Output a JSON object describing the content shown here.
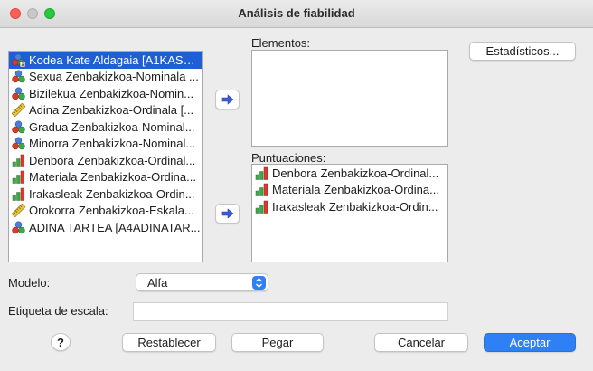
{
  "window": {
    "title": "Análisis de fiabilidad"
  },
  "source_list": {
    "items": [
      {
        "label": "Kodea Kate Aldagaia [A1KASUA]",
        "icon": "nominal-string-icon",
        "selected": true
      },
      {
        "label": "Sexua Zenbakizkoa-Nominala ...",
        "icon": "nominal-icon"
      },
      {
        "label": "Bizilekua Zenbakizkoa-Nomin...",
        "icon": "nominal-icon"
      },
      {
        "label": "Adina Zenbakizkoa-Ordinala [...",
        "icon": "scale-ruler-icon"
      },
      {
        "label": "Gradua Zenbakizkoa-Nominal...",
        "icon": "nominal-icon"
      },
      {
        "label": "Minorra Zenbakizkoa-Nominal...",
        "icon": "nominal-icon"
      },
      {
        "label": "Denbora Zenbakizkoa-Ordinal...",
        "icon": "ordinal-bars-icon"
      },
      {
        "label": "Materiala Zenbakizkoa-Ordina...",
        "icon": "ordinal-bars-icon"
      },
      {
        "label": "Irakasleak Zenbakizkoa-Ordin...",
        "icon": "ordinal-bars-icon"
      },
      {
        "label": "Orokorra Zenbakizkoa-Eskala...",
        "icon": "scale-ruler-icon"
      },
      {
        "label": "ADINA TARTEA [A4ADINATAR...",
        "icon": "nominal-icon"
      }
    ]
  },
  "elementos": {
    "label": "Elementos:",
    "items": []
  },
  "puntuaciones": {
    "label": "Puntuaciones:",
    "items": [
      {
        "label": "Denbora Zenbakizkoa-Ordinal...",
        "icon": "ordinal-bars-icon"
      },
      {
        "label": "Materiala Zenbakizkoa-Ordina...",
        "icon": "ordinal-bars-icon"
      },
      {
        "label": "Irakasleak Zenbakizkoa-Ordin...",
        "icon": "ordinal-bars-icon"
      }
    ]
  },
  "buttons": {
    "estadisticos": "Estadísticos...",
    "help": "?",
    "restablecer": "Restablecer",
    "pegar": "Pegar",
    "cancelar": "Cancelar",
    "aceptar": "Aceptar"
  },
  "modelo": {
    "label": "Modelo:",
    "value": "Alfa"
  },
  "etiqueta": {
    "label": "Etiqueta de escala:",
    "value": ""
  },
  "colors": {
    "accent": "#2f7ff5",
    "selection": "#1f5fd6"
  }
}
